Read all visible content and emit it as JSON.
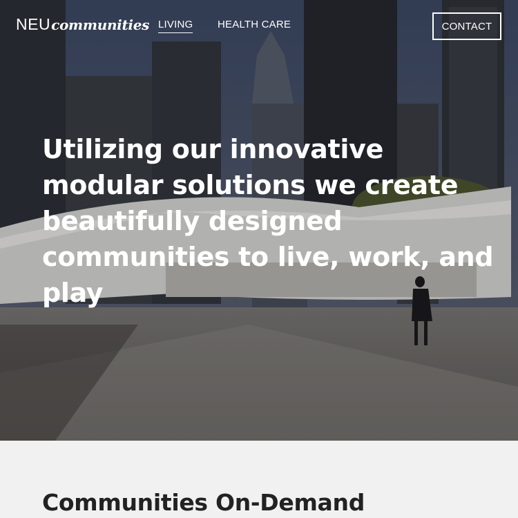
{
  "header": {
    "logo": {
      "primary": "NEU",
      "secondary": "communities"
    },
    "nav": [
      {
        "label": "LIVING",
        "active": true
      },
      {
        "label": "HEALTH CARE",
        "active": false
      }
    ],
    "contact_label": "CONTACT"
  },
  "hero": {
    "headline": "Utilizing our innovative modular solutions we create beautifully designed communities to live, work, and play",
    "background": "city plaza with modern curved pavilion and skyscrapers, person walking"
  },
  "section": {
    "title": "Communities On-Demand"
  },
  "colors": {
    "text_light": "#ffffff",
    "section_bg": "#f1f1f1",
    "section_text": "#222222"
  }
}
